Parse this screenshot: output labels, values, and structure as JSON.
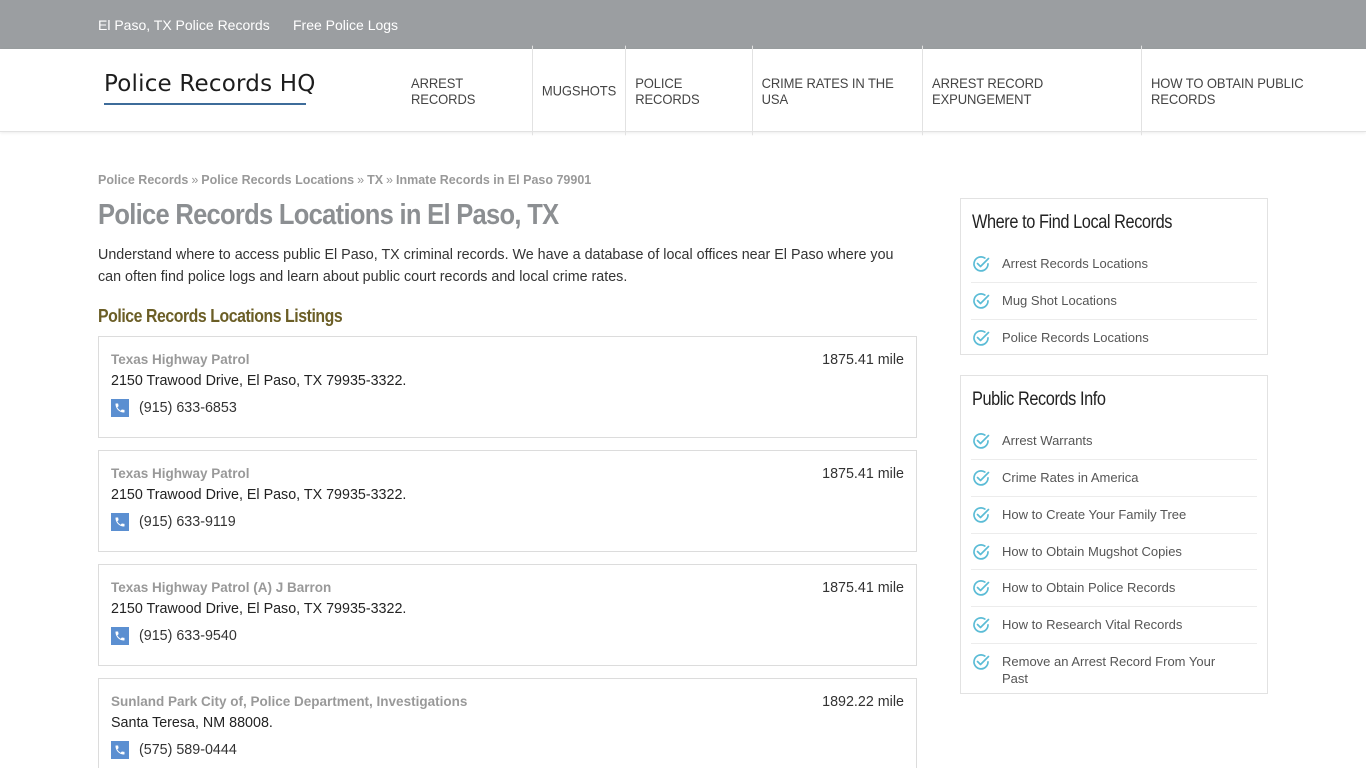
{
  "topbar": {
    "links": [
      "El Paso, TX Police Records",
      "Free Police Logs"
    ]
  },
  "header": {
    "logo": "Police Records HQ",
    "nav": [
      "ARREST RECORDS",
      "MUGSHOTS",
      "POLICE RECORDS",
      "CRIME RATES IN THE USA",
      "ARREST RECORD EXPUNGEMENT",
      "HOW TO OBTAIN PUBLIC RECORDS"
    ]
  },
  "breadcrumb": [
    "Police Records",
    "Police Records Locations",
    "TX",
    "Inmate Records in El Paso 79901"
  ],
  "breadcrumb_sep": "»",
  "main": {
    "title": "Police Records Locations in El Paso, TX",
    "intro": "Understand where to access public El Paso, TX criminal records. We have a database of local offices near El Paso where you can often find police logs and learn about public court records and local crime rates.",
    "section_title": "Police Records Locations Listings",
    "listings": [
      {
        "name": "Texas Highway Patrol",
        "distance": "1875.41 mile",
        "address": "2150 Trawood Drive, El Paso, TX 79935-3322.",
        "phone": "(915) 633-6853"
      },
      {
        "name": "Texas Highway Patrol",
        "distance": "1875.41 mile",
        "address": "2150 Trawood Drive, El Paso, TX 79935-3322.",
        "phone": "(915) 633-9119"
      },
      {
        "name": "Texas Highway Patrol (A) J Barron",
        "distance": "1875.41 mile",
        "address": "2150 Trawood Drive, El Paso, TX 79935-3322.",
        "phone": "(915) 633-9540"
      },
      {
        "name": "Sunland Park City of, Police Department, Investigations",
        "distance": "1892.22 mile",
        "address": "Santa Teresa, NM 88008.",
        "phone": "(575) 589-0444"
      }
    ]
  },
  "sidebar": {
    "widgets": [
      {
        "title": "Where to Find Local Records",
        "items": [
          "Arrest Records Locations",
          "Mug Shot Locations",
          "Police Records Locations"
        ]
      },
      {
        "title": "Public Records Info",
        "items": [
          "Arrest Warrants",
          "Crime Rates in America",
          "How to Create Your Family Tree",
          "How to Obtain Mugshot Copies",
          "How to Obtain Police Records",
          "How to Research Vital Records",
          "Remove an Arrest Record From Your Past"
        ]
      }
    ]
  },
  "colors": {
    "topbar": "#9b9ea1",
    "accent": "#3e6c9a",
    "check": "#5bbcd6",
    "phone_icon": "#5b8fd1",
    "section_title": "#6b5e26"
  },
  "icons": {
    "phone": "phone-icon",
    "check": "check-circle-icon"
  }
}
